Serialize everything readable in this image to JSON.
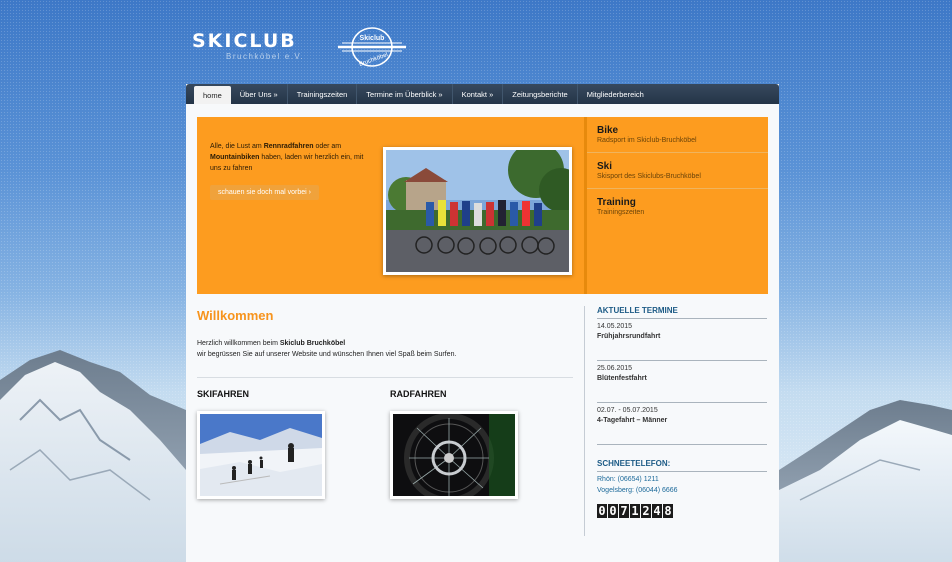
{
  "header": {
    "logo_text": "SKICLUB",
    "logo_sub": "Bruchköbel e.V.",
    "emblem_top": "Skiclub",
    "emblem_bottom": "Bruchköbel"
  },
  "nav": {
    "items": [
      {
        "label": "home",
        "active": true
      },
      {
        "label": "Über Uns »"
      },
      {
        "label": "Trainingszeiten"
      },
      {
        "label": "Termine im Überblick »"
      },
      {
        "label": "Kontakt »"
      },
      {
        "label": "Zeitungsberichte"
      },
      {
        "label": "Mitgliederbereich"
      }
    ]
  },
  "feature": {
    "text_1": "Alle, die Lust am ",
    "text_bold_1": "Rennradfahren",
    "text_2": " oder am ",
    "text_bold_2": "Mountainbiken",
    "text_3": " haben, laden wir herzlich ein, mit uns zu fahren",
    "button": "schauen sie doch mal vorbei",
    "side": [
      {
        "title": "Bike",
        "sub": "Radsport im Skiclub-Bruchköbel"
      },
      {
        "title": "Ski",
        "sub": "Skisport des Skiclubs-Bruchköbel"
      },
      {
        "title": "Training",
        "sub": "Trainingszeiten"
      }
    ]
  },
  "welcome": {
    "title": "Willkommen",
    "line1_a": "Herzlich willkommen beim ",
    "line1_b": "Skiclub Bruchköbel",
    "line2": "wir begrüssen Sie auf unserer Website und wünschen Ihnen viel Spaß beim Surfen."
  },
  "sections": {
    "ski": "SKIFAHREN",
    "bike": "RADFAHREN"
  },
  "termine": {
    "title": "AKTUELLE TERMINE",
    "events": [
      {
        "date": "14.05.2015",
        "name": "Frühjahrsrundfahrt"
      },
      {
        "date": "25.06.2015",
        "name": "Blütenfestfahrt"
      },
      {
        "date": "02.07. - 05.07.2015",
        "name": "4-Tagefahrt – Männer"
      }
    ]
  },
  "schneetelefon": {
    "title": "SCHNEETELEFON:",
    "lines": [
      "Rhön: (06654) 1211",
      "Vogelsberg: (06044) 6666"
    ]
  },
  "counter": "0071248",
  "colors": {
    "accent_orange": "#fd9c1f",
    "title_orange": "#f7941d",
    "nav_dark": "#243447",
    "link_blue": "#1d5b86"
  }
}
